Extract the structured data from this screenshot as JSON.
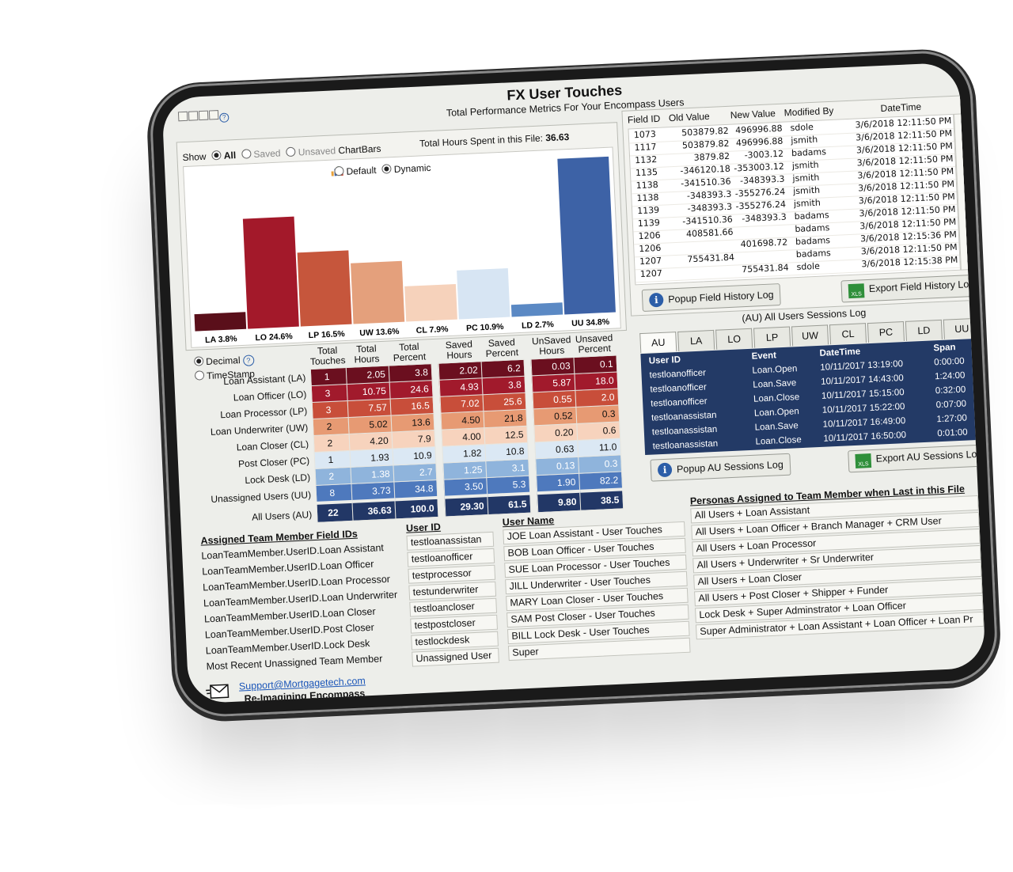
{
  "header": {
    "title": "FX User Touches",
    "subtitle": "Total Performance Metrics For Your Encompass Users"
  },
  "show": {
    "label": "Show",
    "options": [
      "All",
      "Saved",
      "Unsaved"
    ],
    "selected": "All",
    "chartbars_label": "ChartBars",
    "total_hours_label": "Total Hours Spent in this File:",
    "total_hours_value": "36.63"
  },
  "chart_mode": {
    "options": [
      "Default",
      "Dynamic"
    ],
    "selected": "Dynamic"
  },
  "chart_data": {
    "type": "bar",
    "categories": [
      "LA",
      "LO",
      "LP",
      "UW",
      "CL",
      "PC",
      "LD",
      "UU"
    ],
    "values": [
      3.8,
      24.6,
      16.5,
      13.6,
      7.9,
      10.9,
      2.7,
      34.8
    ],
    "labels": [
      "LA 3.8%",
      "LO 24.6%",
      "LP 16.5%",
      "UW 13.6%",
      "CL 7.9%",
      "PC 10.9%",
      "LD 2.7%",
      "UU 34.8%"
    ],
    "colors": [
      "#5a0f1a",
      "#a3192a",
      "#c6563c",
      "#e4a07c",
      "#f6d2bb",
      "#d7e5f3",
      "#5b89c4",
      "#3d62a6"
    ],
    "ylim": [
      0,
      35
    ]
  },
  "metrics": {
    "format_options": [
      "Decimal",
      "TimeStamp"
    ],
    "format_selected": "Decimal",
    "headers": [
      "Total Touches",
      "Total Hours",
      "Total Percent",
      "Saved Hours",
      "Saved Percent",
      "UnSaved Hours",
      "Unsaved Percent"
    ],
    "rows": [
      {
        "label": "Loan Assistant (LA)",
        "vals": [
          "1",
          "2.05",
          "3.8",
          "2.02",
          "6.2",
          "0.03",
          "0.1"
        ]
      },
      {
        "label": "Loan Officer (LO)",
        "vals": [
          "3",
          "10.75",
          "24.6",
          "4.93",
          "3.8",
          "5.87",
          "18.0"
        ]
      },
      {
        "label": "Loan Processor (LP)",
        "vals": [
          "3",
          "7.57",
          "16.5",
          "7.02",
          "25.6",
          "0.55",
          "2.0"
        ]
      },
      {
        "label": "Loan Underwriter (UW)",
        "vals": [
          "2",
          "5.02",
          "13.6",
          "4.50",
          "21.8",
          "0.52",
          "0.3"
        ]
      },
      {
        "label": "Loan Closer (CL)",
        "vals": [
          "2",
          "4.20",
          "7.9",
          "4.00",
          "12.5",
          "0.20",
          "0.6"
        ]
      },
      {
        "label": "Post Closer (PC)",
        "vals": [
          "1",
          "1.93",
          "10.9",
          "1.82",
          "10.8",
          "0.63",
          "11.0"
        ]
      },
      {
        "label": "Lock Desk (LD)",
        "vals": [
          "2",
          "1.38",
          "2.7",
          "1.25",
          "3.1",
          "0.13",
          "0.3"
        ]
      },
      {
        "label": "Unassigned Users (UU)",
        "vals": [
          "8",
          "3.73",
          "34.8",
          "3.50",
          "5.3",
          "1.90",
          "82.2"
        ]
      },
      {
        "label": "All Users (AU)",
        "vals": [
          "22",
          "36.63",
          "100.0",
          "29.30",
          "61.5",
          "9.80",
          "38.5"
        ]
      }
    ]
  },
  "field_history": {
    "headers": [
      "Field ID",
      "Old Value",
      "New Value",
      "Modified By",
      "DateTime"
    ],
    "rows": [
      [
        "1073",
        "503879.82",
        "496996.88",
        "sdole",
        "3/6/2018 12:11:50 PM"
      ],
      [
        "1117",
        "503879.82",
        "496996.88",
        "jsmith",
        "3/6/2018 12:11:50 PM"
      ],
      [
        "1132",
        "3879.82",
        "-3003.12",
        "badams",
        "3/6/2018 12:11:50 PM"
      ],
      [
        "1135",
        "-346120.18",
        "-353003.12",
        "jsmith",
        "3/6/2018 12:11:50 PM"
      ],
      [
        "1138",
        "-341510.36",
        "-348393.3",
        "jsmith",
        "3/6/2018 12:11:50 PM"
      ],
      [
        "1138",
        "-348393.3",
        "-355276.24",
        "jsmith",
        "3/6/2018 12:11:50 PM"
      ],
      [
        "1139",
        "-348393.3",
        "-355276.24",
        "jsmith",
        "3/6/2018 12:11:50 PM"
      ],
      [
        "1139",
        "-341510.36",
        "-348393.3",
        "badams",
        "3/6/2018 12:11:50 PM"
      ],
      [
        "1206",
        "408581.66",
        "",
        "badams",
        "3/6/2018 12:11:50 PM"
      ],
      [
        "1206",
        "",
        "401698.72",
        "badams",
        "3/6/2018 12:15:36 PM"
      ],
      [
        "1207",
        "755431.84",
        "",
        "badams",
        "3/6/2018 12:11:50 PM"
      ],
      [
        "1207",
        "",
        "755431.84",
        "sdole",
        "3/6/2018 12:15:38 PM"
      ]
    ],
    "popup_btn": "Popup Field History Log",
    "export_btn": "Export Field History Log",
    "xls_icon_text": "XLS"
  },
  "sessions": {
    "title": "(AU) All Users Sessions Log",
    "tabs": [
      "AU",
      "LA",
      "LO",
      "LP",
      "UW",
      "CL",
      "PC",
      "LD",
      "UU"
    ],
    "active_tab": "AU",
    "headers": [
      "User ID",
      "Event",
      "DateTime",
      "Span"
    ],
    "rows": [
      [
        "testloanofficer",
        "Loan.Open",
        "10/11/2017 13:19:00",
        "0:00:00"
      ],
      [
        "testloanofficer",
        "Loan.Save",
        "10/11/2017 14:43:00",
        "1:24:00"
      ],
      [
        "testloanofficer",
        "Loan.Close",
        "10/11/2017 15:15:00",
        "0:32:00"
      ],
      [
        "testloanassistan",
        "Loan.Open",
        "10/11/2017 15:22:00",
        "0:07:00"
      ],
      [
        "testloanassistan",
        "Loan.Save",
        "10/11/2017 16:49:00",
        "1:27:00"
      ],
      [
        "testloanassistan",
        "Loan.Close",
        "10/11/2017 16:50:00",
        "0:01:00"
      ]
    ],
    "popup_btn": "Popup AU Sessions Log",
    "export_btn": "Export AU Sessions Log"
  },
  "assigned": {
    "field_ids_title": "Assigned Team Member Field IDs",
    "field_ids": [
      "LoanTeamMember.UserID.Loan Assistant",
      "LoanTeamMember.UserID.Loan Officer",
      "LoanTeamMember.UserID.Loan Processor",
      "LoanTeamMember.UserID.Loan Underwriter",
      "LoanTeamMember.UserID.Loan Closer",
      "LoanTeamMember.UserID.Post Closer",
      "LoanTeamMember.UserID.Lock Desk",
      "Most Recent Unassigned Team Member"
    ],
    "user_id_title": "User ID",
    "user_ids": [
      "testloanassistan",
      "testloanofficer",
      "testprocessor",
      "testunderwriter",
      "testloancloser",
      "testpostcloser",
      "testlockdesk",
      "Unassigned User"
    ],
    "user_name_title": "User Name",
    "user_names": [
      "JOE Loan Assistant -  User Touches",
      "BOB Loan Officer -  User Touches",
      "SUE Loan Processor -  User Touches",
      "JILL Underwriter -  User Touches",
      "MARY Loan Closer -  User Touches",
      "SAM Post Closer -  User Touches",
      "BILL Lock Desk - User Touches",
      "Super"
    ],
    "personas_title": "Personas Assigned to Team Member when Last in this File",
    "personas": [
      "All Users + Loan Assistant",
      "All Users + Loan Officer + Branch Manager + CRM User",
      "All Users + Loan Processor",
      "All Users + Underwriter + Sr Underwriter",
      "All Users + Loan Closer",
      "All Users + Post Closer + Shipper + Funder",
      "Lock Desk + Super Adminstrator + Loan Officer",
      "Super Administrator + Loan Assistant + Loan Officer + Loan Pr"
    ]
  },
  "footer": {
    "email": "Support@Mortgagetech.com",
    "tagline": "Re-Imagining Encompass"
  },
  "colors": {
    "heat": [
      "#6b0f1f",
      "#a11a2c",
      "#c84e3a",
      "#e79a73",
      "#f7d3bd",
      "#dbe8f4",
      "#8fb4dc",
      "#4e79bd",
      "#223766"
    ],
    "session_bg": "#233a66",
    "link": "#1a55b8"
  }
}
